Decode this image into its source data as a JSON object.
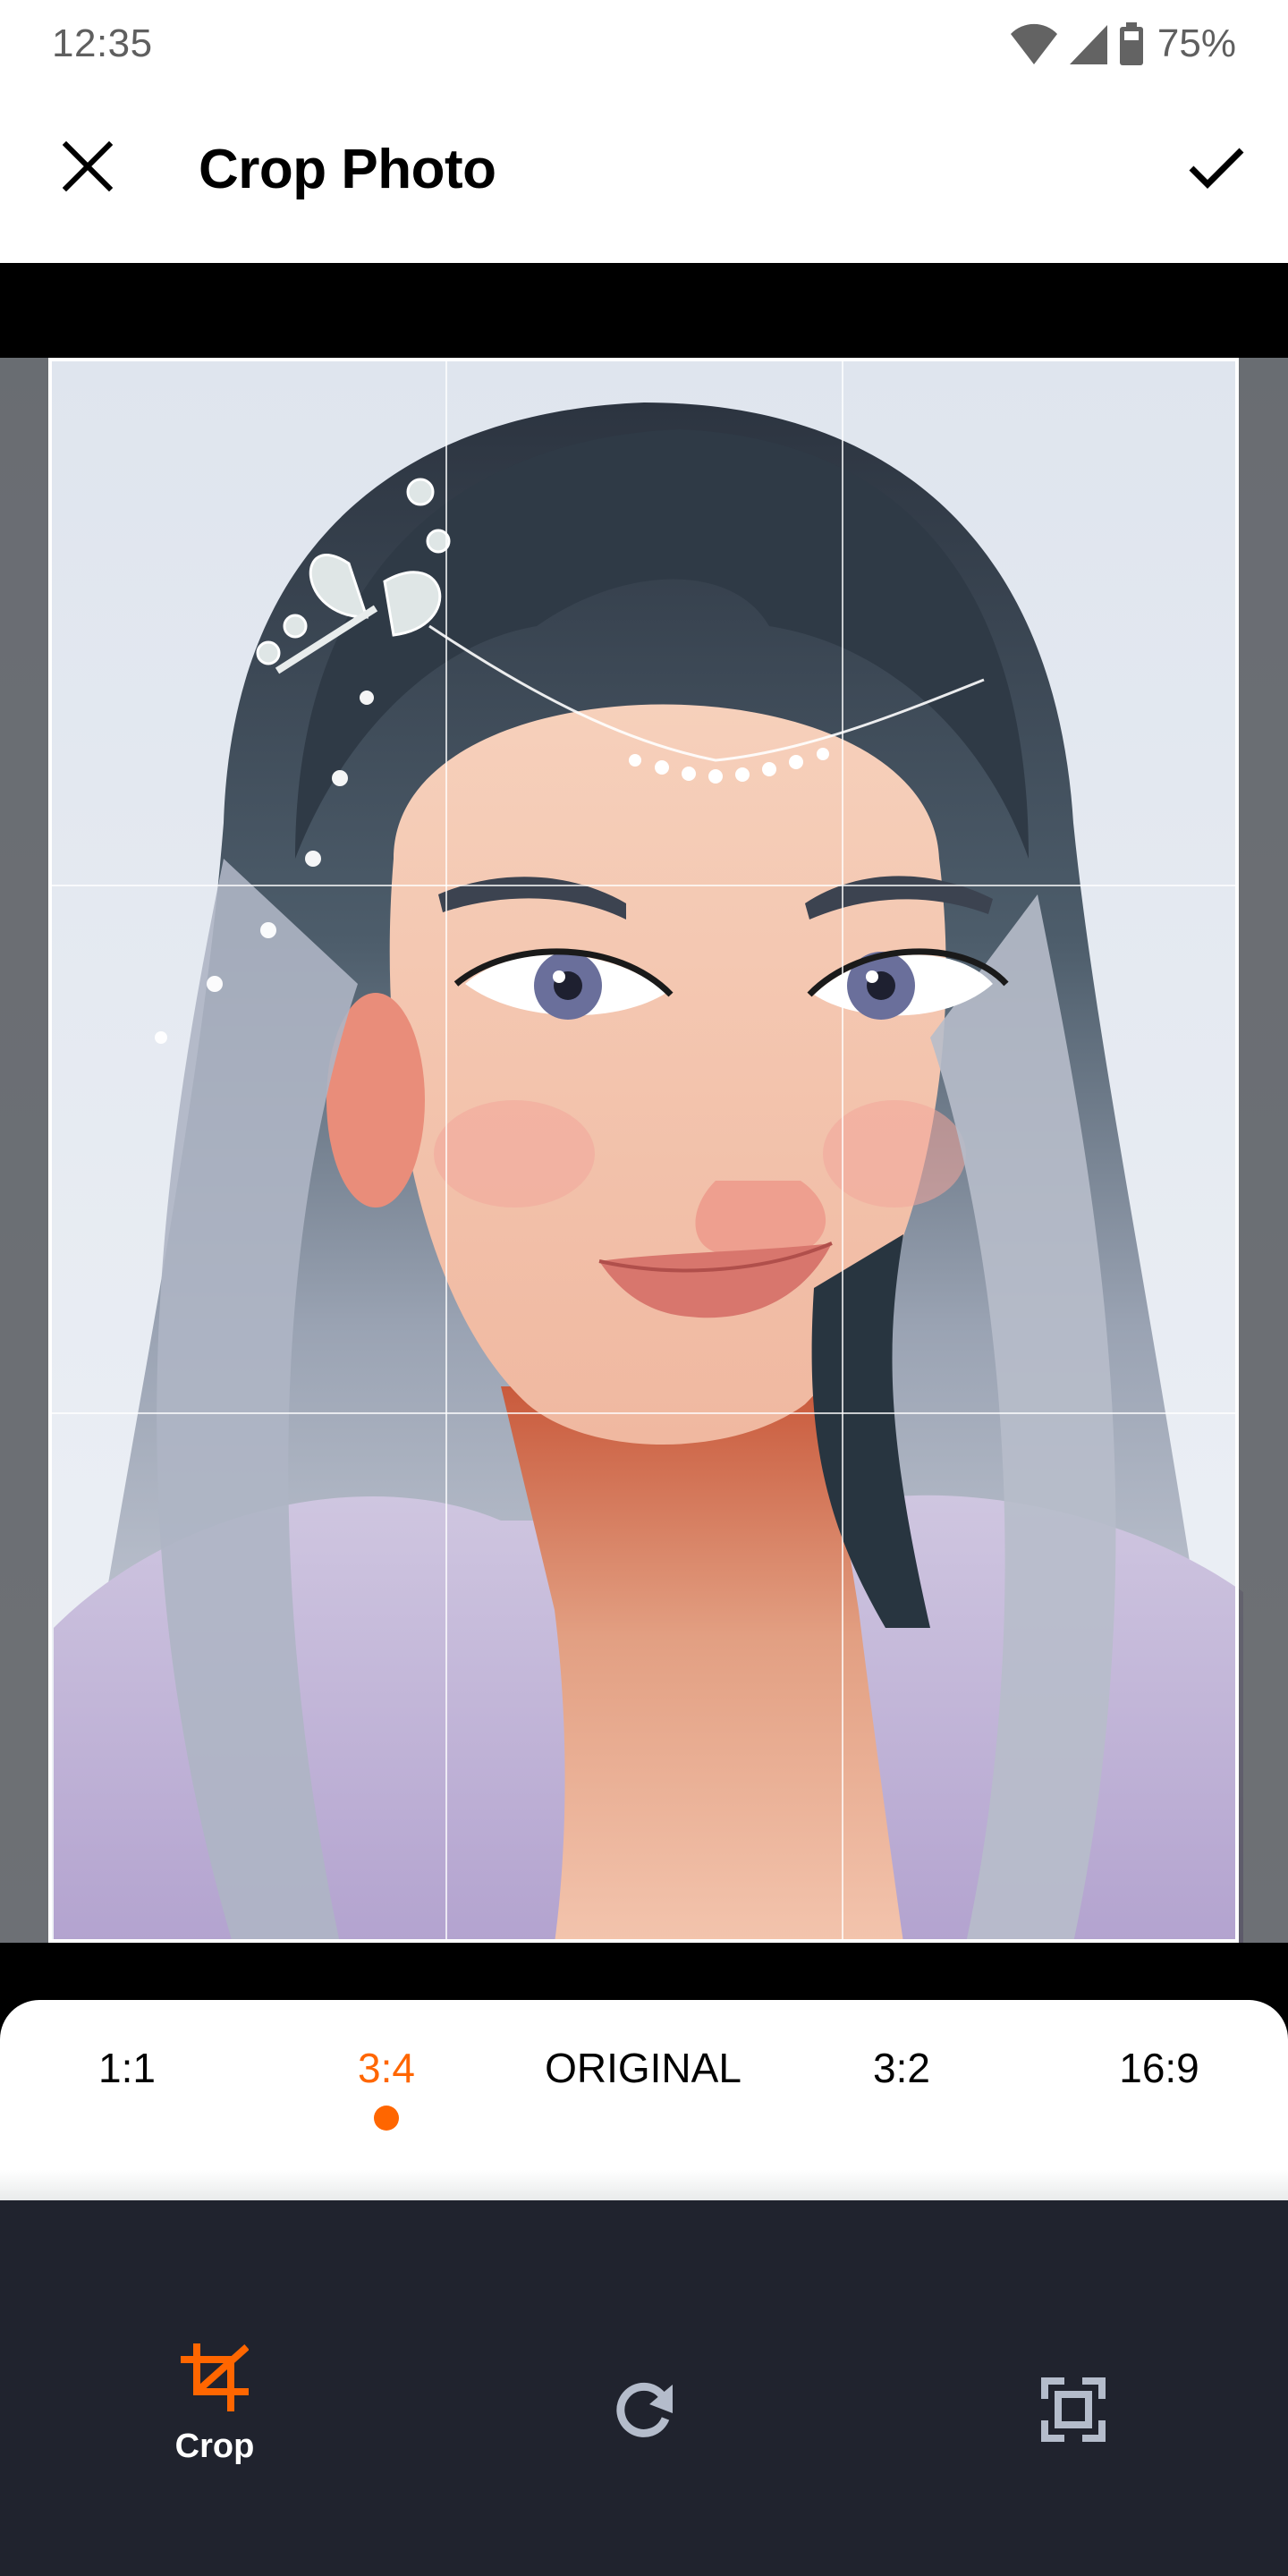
{
  "status_bar": {
    "time": "12:35",
    "battery_percent": "75%",
    "icons": [
      "wifi-icon",
      "cellular-signal-icon",
      "battery-icon"
    ]
  },
  "app_bar": {
    "title": "Crop Photo",
    "close_icon": "close-icon",
    "confirm_icon": "checkmark-icon"
  },
  "crop": {
    "aspect_ratio": "3:4",
    "grid": "rule-of-thirds"
  },
  "ratios": {
    "selected": "3:4",
    "items": [
      {
        "label": "1:1",
        "active": false
      },
      {
        "label": "3:4",
        "active": true
      },
      {
        "label": "ORIGINAL",
        "active": false
      },
      {
        "label": "3:2",
        "active": false
      },
      {
        "label": "16:9",
        "active": false
      }
    ]
  },
  "bottom_nav": {
    "items": [
      {
        "label": "Crop",
        "icon": "crop-icon",
        "active": true
      },
      {
        "label": "",
        "icon": "rotate-icon",
        "active": false
      },
      {
        "label": "",
        "icon": "fit-screen-icon",
        "active": false
      }
    ]
  },
  "colors": {
    "accent": "#ff6600",
    "nav_background": "#20232e",
    "nav_icon": "#b4bccb",
    "frame": "#ffffff"
  }
}
